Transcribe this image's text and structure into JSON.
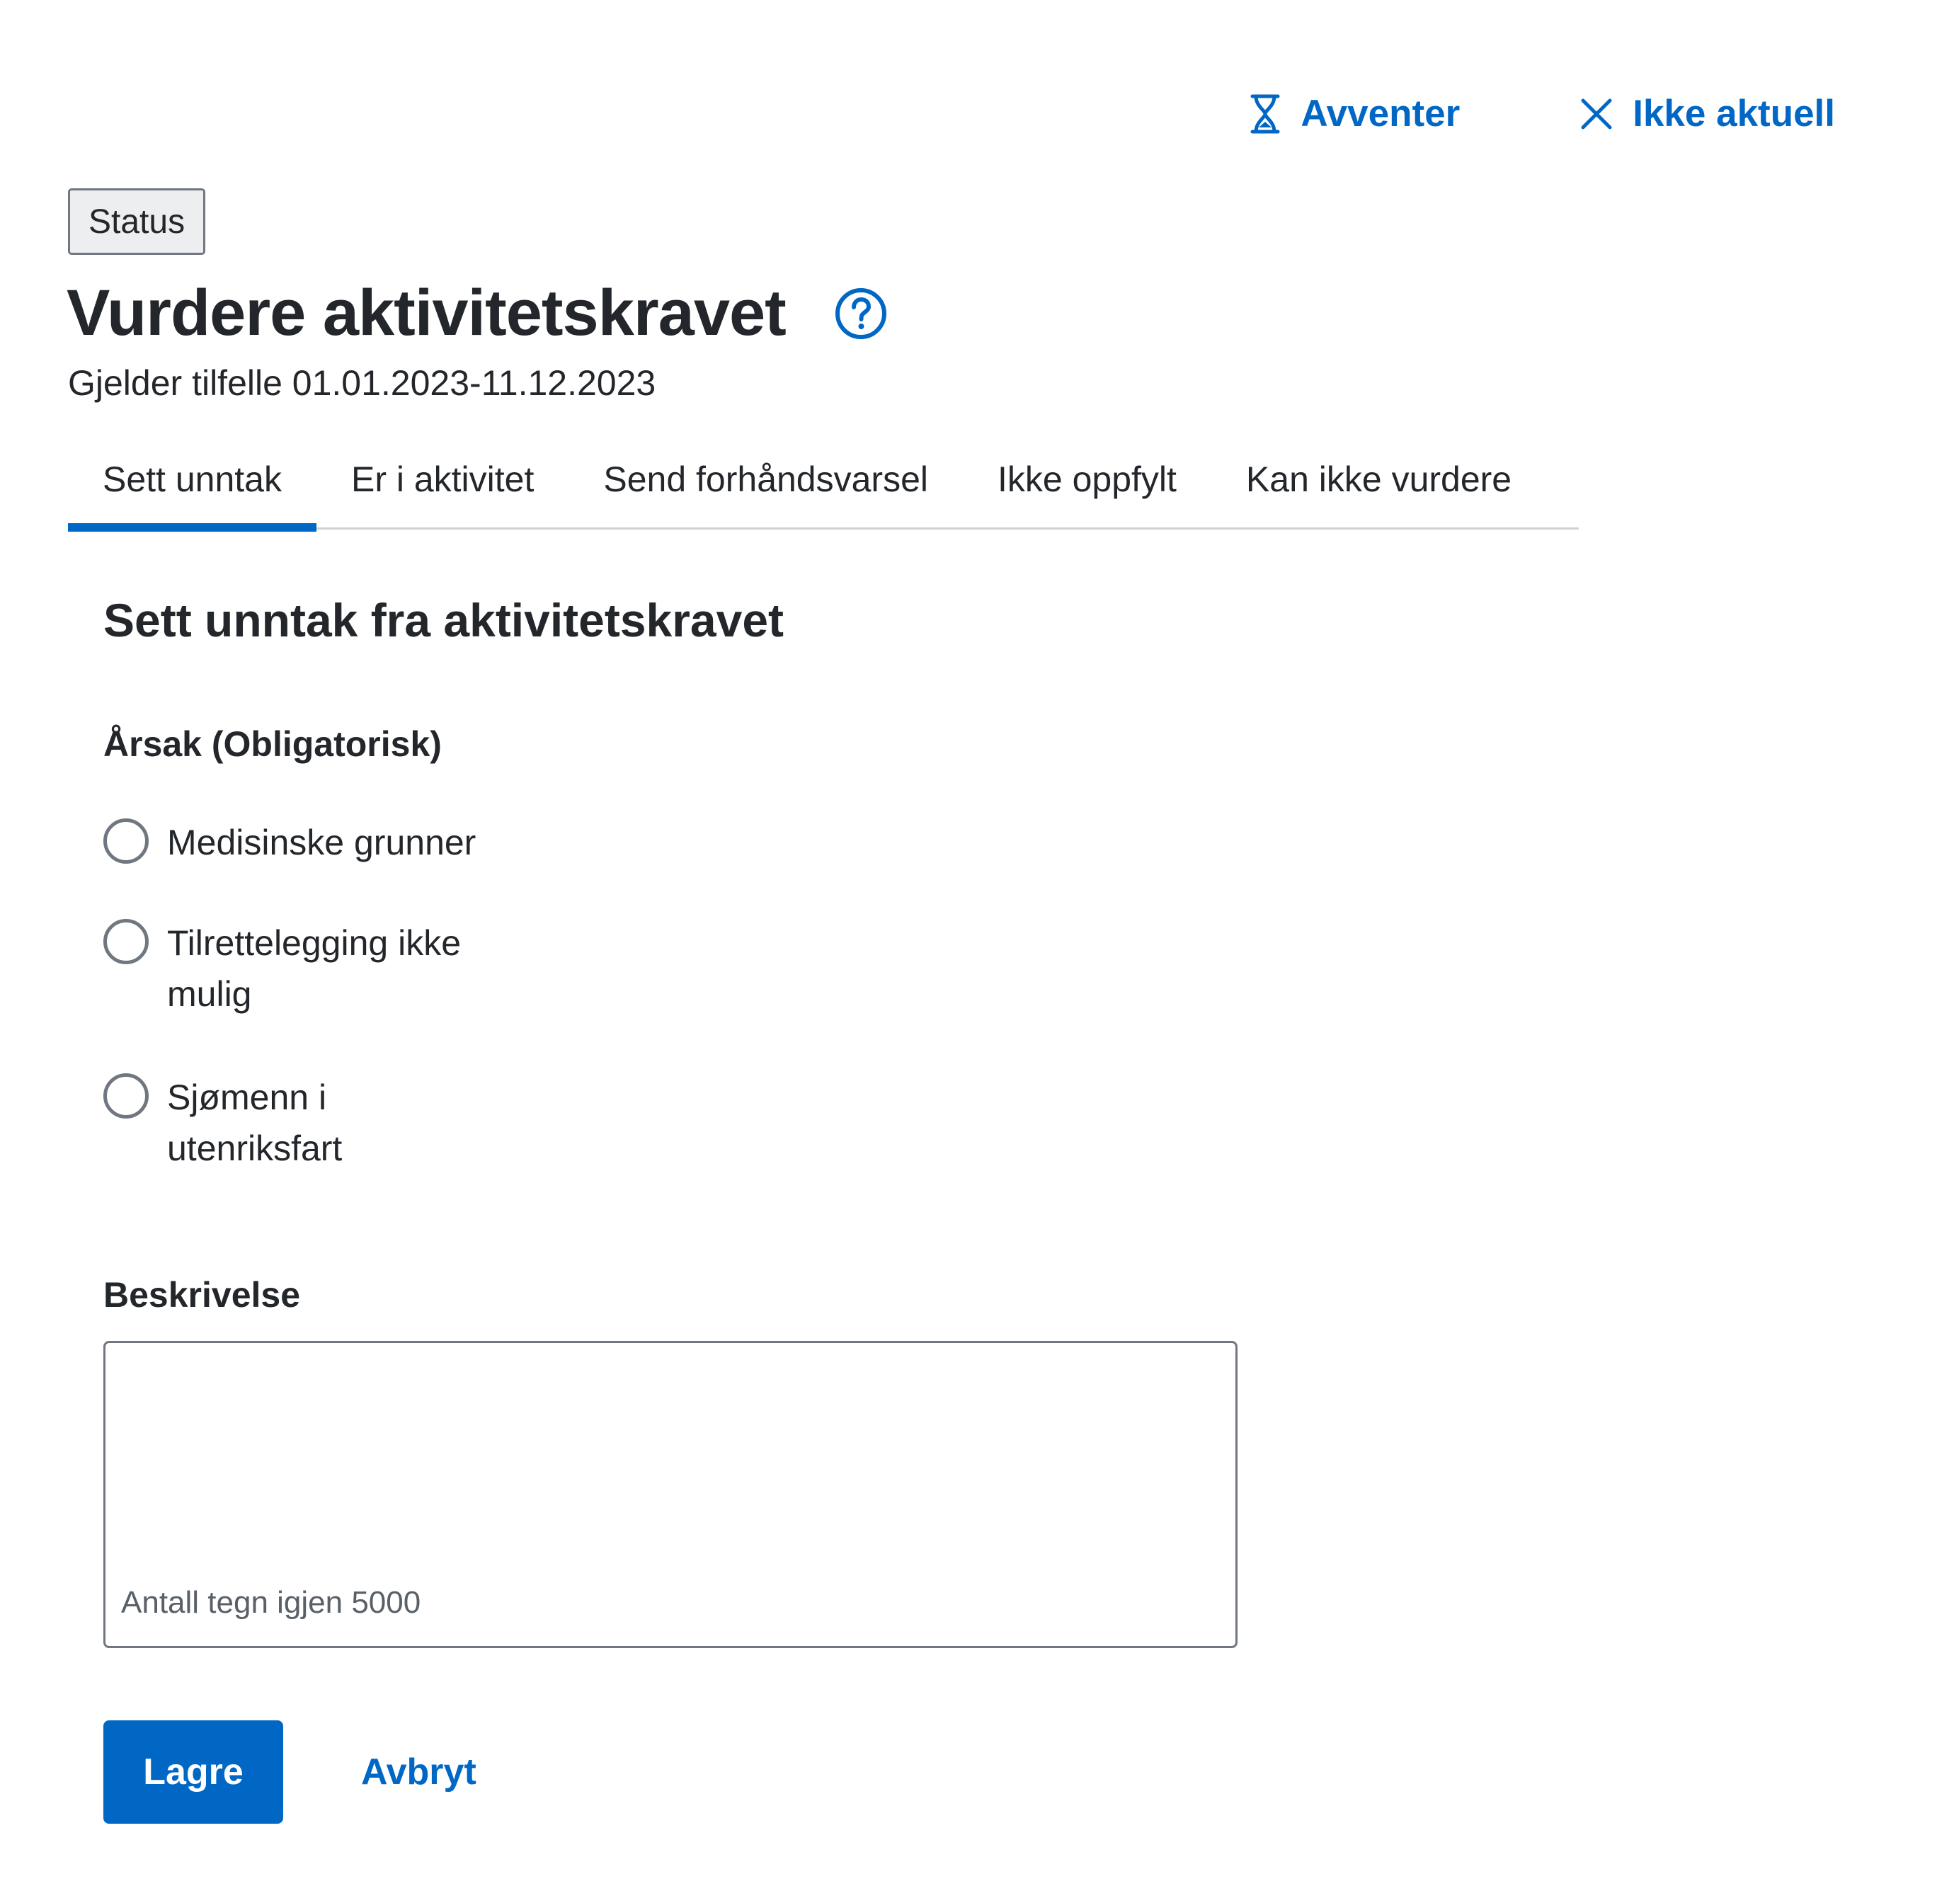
{
  "header": {
    "actions": {
      "wait_label": "Avventer",
      "wait_icon": "hourglass-icon",
      "not_relevant_label": "Ikke aktuell",
      "not_relevant_icon": "close-icon"
    },
    "status_tag": "Status",
    "title": "Vurdere aktivitetskravet",
    "help_icon": "help-circle-icon",
    "subtitle": "Gjelder tilfelle 01.01.2023-11.12.2023"
  },
  "tabs": [
    {
      "label": "Sett unntak",
      "active": true
    },
    {
      "label": "Er i aktivitet",
      "active": false
    },
    {
      "label": "Send forhåndsvarsel",
      "active": false
    },
    {
      "label": "Ikke oppfylt",
      "active": false
    },
    {
      "label": "Kan ikke vurdere",
      "active": false
    }
  ],
  "form": {
    "section_title": "Sett unntak fra aktivitetskravet",
    "cause_label": "Årsak (Obligatorisk)",
    "options": [
      {
        "label": "Medisinske grunner",
        "checked": false
      },
      {
        "label": "Tilrettelegging ikke mulig",
        "checked": false
      },
      {
        "label": "Sjømenn i utenriksfart",
        "checked": false
      }
    ],
    "description_label": "Beskrivelse",
    "description_value": "",
    "char_count_text": "Antall tegn igjen 5000",
    "save_label": "Lagre",
    "cancel_label": "Avbryt"
  },
  "colors": {
    "accent": "#0067c5",
    "text": "#23262a",
    "border": "#707780",
    "tab_divider": "#cfd3d8",
    "tag_background": "#eceef0"
  }
}
